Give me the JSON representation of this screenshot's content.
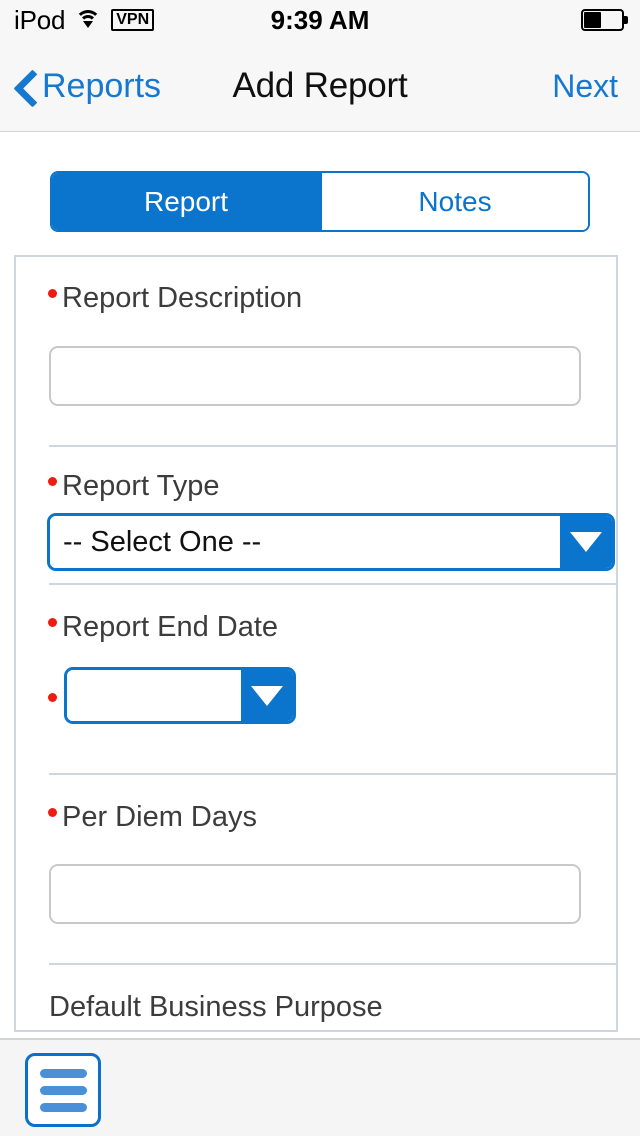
{
  "status_bar": {
    "carrier": "iPod",
    "wifi_icon": "wifi-icon",
    "vpn_label": "VPN",
    "time": "9:39 AM",
    "battery_icon": "battery-icon",
    "battery_percent": 45
  },
  "nav_bar": {
    "back_icon": "chevron-left-icon",
    "back_label": "Reports",
    "title": "Add Report",
    "next_label": "Next"
  },
  "segmented_control": {
    "segments": [
      {
        "label": "Report",
        "selected": true
      },
      {
        "label": "Notes",
        "selected": false
      }
    ]
  },
  "form": {
    "fields": [
      {
        "label": "Report Description",
        "required": true,
        "type": "text",
        "value": "",
        "placeholder": ""
      },
      {
        "label": "Report Type",
        "required": true,
        "type": "select",
        "value": "-- Select One --",
        "dropdown_icon": "chevron-down-icon"
      },
      {
        "label": "Report End Date",
        "required": true,
        "type": "date",
        "value": "",
        "dropdown_icon": "chevron-down-icon"
      },
      {
        "label": "Per Diem Days",
        "required": true,
        "type": "text",
        "value": "",
        "placeholder": ""
      },
      {
        "label": "Default Business Purpose",
        "required": false,
        "type": "text",
        "value": "",
        "placeholder": ""
      }
    ]
  },
  "toolbar": {
    "menu_icon": "hamburger-menu-icon"
  },
  "colors": {
    "accent_blue": "#0b74cc",
    "link_blue": "#1679d0",
    "required_red": "#ee1b11",
    "card_border": "#ced6df",
    "input_border": "#c8c8c8",
    "chrome_bg": "#f7f7f7"
  }
}
